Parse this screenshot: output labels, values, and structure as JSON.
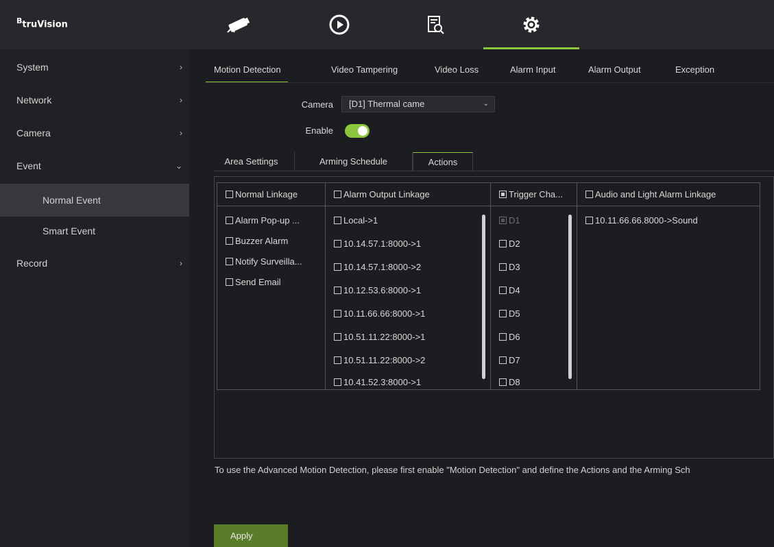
{
  "brand": {
    "logo_mark": "B",
    "logo_text": "truVision"
  },
  "top_tabs": [
    {
      "name": "camera-icon",
      "active": false
    },
    {
      "name": "playback-icon",
      "active": false
    },
    {
      "name": "search-icon",
      "active": false
    },
    {
      "name": "gear-icon",
      "active": true
    }
  ],
  "sidebar": {
    "items": [
      {
        "label": "System",
        "chevron": "›"
      },
      {
        "label": "Network",
        "chevron": "›"
      },
      {
        "label": "Camera",
        "chevron": "›"
      },
      {
        "label": "Event",
        "chevron": "⌄"
      },
      {
        "label": "Record",
        "chevron": "›"
      }
    ],
    "subitems": [
      {
        "label": "Normal Event",
        "active": true
      },
      {
        "label": "Smart Event",
        "active": false
      }
    ]
  },
  "subtabs": [
    "Motion Detection",
    "Video Tampering",
    "Video Loss",
    "Alarm Input",
    "Alarm Output",
    "Exception"
  ],
  "form": {
    "camera_label": "Camera",
    "camera_value": "[D1] Thermal came",
    "enable_label": "Enable",
    "enable_on": true
  },
  "inner_tabs": [
    "Area Settings",
    "Arming Schedule",
    "Actions"
  ],
  "linkage": {
    "normal": {
      "header": "Normal Linkage",
      "items": [
        "Alarm Pop-up ...",
        "Buzzer Alarm",
        "Notify Surveilla...",
        "Send Email"
      ]
    },
    "alarm_output": {
      "header": "Alarm Output Linkage",
      "items": [
        "Local->1",
        "10.14.57.1:8000->1",
        "10.14.57.1:8000->2",
        "10.12.53.6:8000->1",
        "10.11.66.66:8000->1",
        "10.51.11.22:8000->1",
        "10.51.11.22:8000->2",
        "10.41.52.3:8000->1"
      ]
    },
    "trigger": {
      "header": "Trigger Cha...",
      "items": [
        "D1",
        "D2",
        "D3",
        "D4",
        "D5",
        "D6",
        "D7",
        "D8"
      ]
    },
    "audio_light": {
      "header": "Audio and Light Alarm Linkage",
      "items": [
        "10.11.66.66.8000->Sound"
      ]
    }
  },
  "notice": "To use the Advanced Motion Detection, please first enable \"Motion Detection\" and define the Actions and the Arming Sch",
  "apply_label": "Apply",
  "colors": {
    "accent": "#8dc63f",
    "apply_bg": "#5a7d2a"
  }
}
